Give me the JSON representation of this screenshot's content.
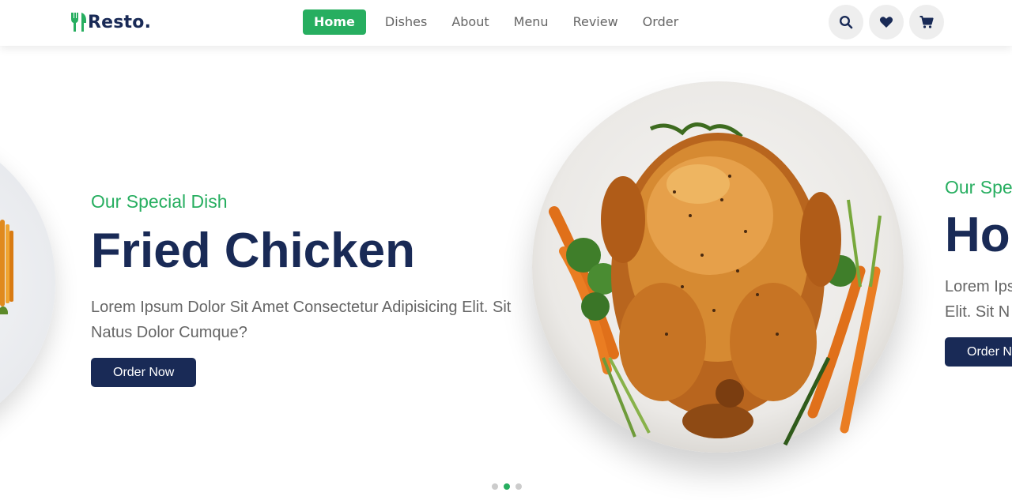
{
  "brand": {
    "name": "Resto.",
    "icon": "utensils-icon",
    "accent": "#27ae60",
    "primary": "#192a56"
  },
  "nav": {
    "items": [
      {
        "label": "Home",
        "active": true
      },
      {
        "label": "Dishes",
        "active": false
      },
      {
        "label": "About",
        "active": false
      },
      {
        "label": "Menu",
        "active": false
      },
      {
        "label": "Review",
        "active": false
      },
      {
        "label": "Order",
        "active": false
      }
    ]
  },
  "header_icons": [
    "search-icon",
    "heart-icon",
    "cart-icon"
  ],
  "slides": {
    "current": {
      "subtitle": "Our Special Dish",
      "title": "Fried Chicken",
      "description": "Lorem Ipsum Dolor Sit Amet Consectetur Adipisicing Elit. Sit Natus Dolor Cumque?",
      "button": "Order Now"
    },
    "next": {
      "subtitle": "Our Spe",
      "title": "Ho",
      "description_line1": "Lorem Ips",
      "description_line2": "Elit. Sit N",
      "button": "Order N"
    }
  },
  "pagination": {
    "count": 3,
    "active_index": 1
  }
}
